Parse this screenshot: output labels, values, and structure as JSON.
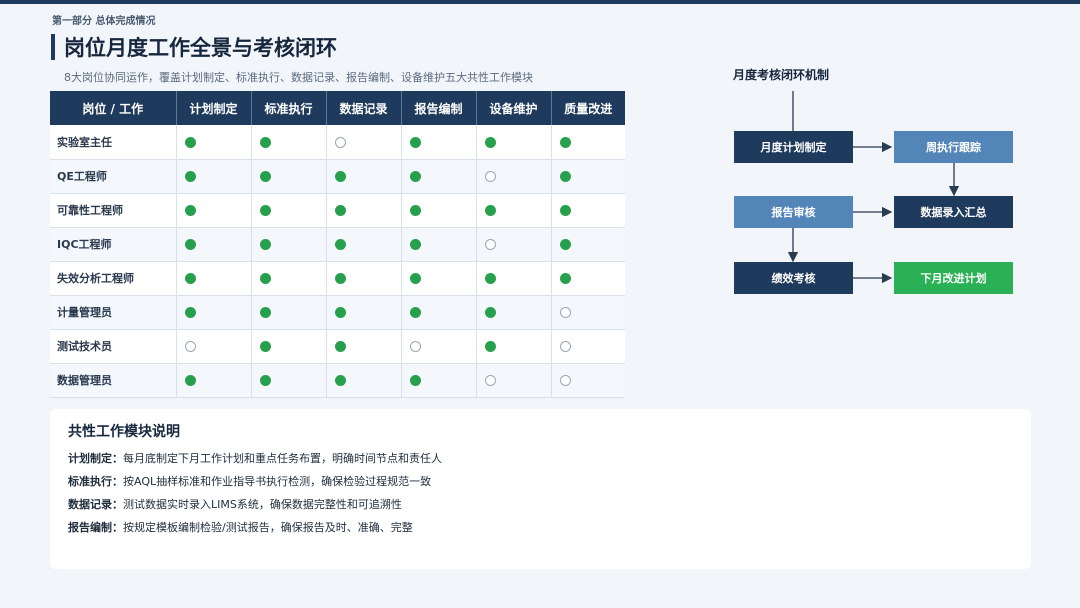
{
  "header": {
    "section_tag": "第一部分 总体完成情况",
    "title": "岗位月度工作全景与考核闭环",
    "subtitle": "8大岗位协同运作，覆盖计划制定、标准执行、数据记录、报告编制、设备维护五大共性工作模块"
  },
  "matrix": {
    "columns": [
      "岗位 / 工作",
      "计划制定",
      "标准执行",
      "数据记录",
      "报告编制",
      "设备维护",
      "质量改进"
    ],
    "rows": [
      {
        "role": "实验室主任",
        "marks": [
          true,
          true,
          false,
          true,
          true,
          true
        ]
      },
      {
        "role": "QE工程师",
        "marks": [
          true,
          true,
          true,
          true,
          false,
          true
        ]
      },
      {
        "role": "可靠性工程师",
        "marks": [
          true,
          true,
          true,
          true,
          true,
          true
        ]
      },
      {
        "role": "IQC工程师",
        "marks": [
          true,
          true,
          true,
          true,
          false,
          true
        ]
      },
      {
        "role": "失效分析工程师",
        "marks": [
          true,
          true,
          true,
          true,
          true,
          true
        ]
      },
      {
        "role": "计量管理员",
        "marks": [
          true,
          true,
          true,
          true,
          true,
          false
        ]
      },
      {
        "role": "测试技术员",
        "marks": [
          false,
          true,
          true,
          false,
          true,
          false
        ]
      },
      {
        "role": "数据管理员",
        "marks": [
          true,
          true,
          true,
          true,
          false,
          false
        ]
      }
    ],
    "colors": {
      "on": "#27a04e",
      "off": "#ffffff"
    }
  },
  "flow": {
    "title": "月度考核闭环机制",
    "steps": {
      "plan": "月度计划制定",
      "track": "周执行跟踪",
      "review": "报告审核",
      "data": "数据录入汇总",
      "appraise": "绩效考核",
      "next": "下月改进计划"
    },
    "colors": {
      "dark": "#1e3a5c",
      "mid": "#5485b8",
      "green": "#2ab155"
    }
  },
  "modules": {
    "title": "共性工作模块说明",
    "items": [
      {
        "label": "计划制定：",
        "text": "每月底制定下月工作计划和重点任务布置，明确时间节点和责任人"
      },
      {
        "label": "标准执行：",
        "text": "按AQL抽样标准和作业指导书执行检测，确保检验过程规范一致"
      },
      {
        "label": "数据记录：",
        "text": "测试数据实时录入LIMS系统，确保数据完整性和可追溯性"
      },
      {
        "label": "报告编制：",
        "text": "按规定模板编制检验/测试报告，确保报告及时、准确、完整"
      }
    ]
  }
}
